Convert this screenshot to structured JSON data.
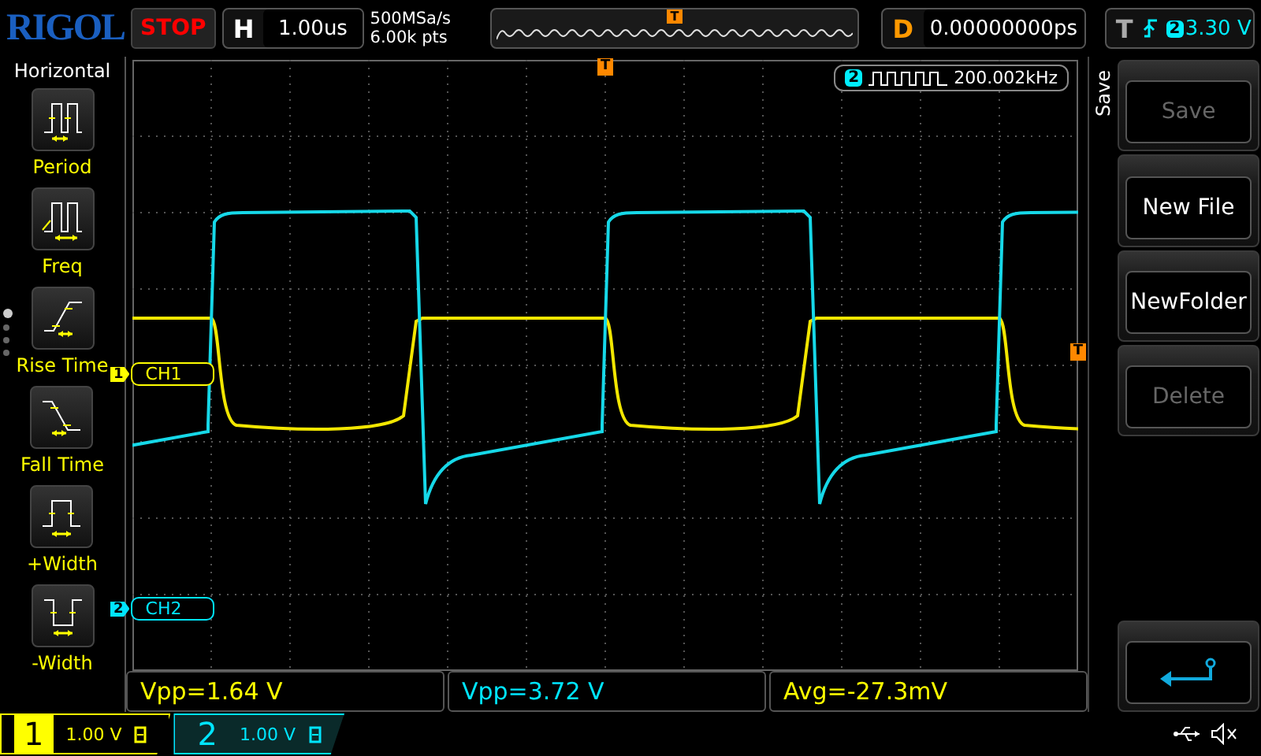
{
  "header": {
    "brand": "RIGOL",
    "run_state": "STOP",
    "timebase": {
      "label": "H",
      "value": "1.00us"
    },
    "sample_rate": "500MSa/s",
    "memory_depth": "6.00k pts",
    "overview_marker": "T",
    "delay": {
      "label": "D",
      "value": "0.00000000ps"
    },
    "trigger": {
      "label": "T",
      "source": "2",
      "level": "3.30 V"
    }
  },
  "left_menu": {
    "title": "Horizontal",
    "items": [
      {
        "label": "Period",
        "kind": "period"
      },
      {
        "label": "Freq",
        "kind": "freq"
      },
      {
        "label": "Rise Time",
        "kind": "rise"
      },
      {
        "label": "Fall Time",
        "kind": "fall"
      },
      {
        "label": "+Width",
        "kind": "pwidth"
      },
      {
        "label": "-Width",
        "kind": "nwidth"
      }
    ],
    "pages": [
      {
        "selected": true
      },
      {
        "selected": false
      },
      {
        "selected": false
      },
      {
        "selected": false
      }
    ]
  },
  "display": {
    "top_trigger_marker": "T",
    "side_trigger_marker": "T",
    "frequency_counter": {
      "channel": "2",
      "value": "200.002kHz"
    },
    "channel_markers": [
      {
        "number": "1",
        "label": "CH1",
        "color": "#ffff00"
      },
      {
        "number": "2",
        "label": "CH2",
        "color": "#00e5ff"
      }
    ]
  },
  "measurements": [
    {
      "text": "Vpp=1.64 V",
      "color": "#ffff00"
    },
    {
      "text": "Vpp=3.72 V",
      "color": "#00e5ff"
    },
    {
      "text": "Avg=-27.3mV",
      "color": "#ffff00"
    }
  ],
  "right_menu": {
    "title": "Save",
    "buttons": [
      {
        "kind": "text",
        "label": "Save",
        "disabled": true
      },
      {
        "kind": "text",
        "label": "New File",
        "disabled": false
      },
      {
        "kind": "text",
        "label": "NewFolder",
        "disabled": false
      },
      {
        "kind": "text",
        "label": "Delete",
        "disabled": true
      },
      {
        "kind": "spacer"
      },
      {
        "kind": "back"
      }
    ]
  },
  "channels": [
    {
      "number": "1",
      "scale": "1.00 V",
      "active": true,
      "color": "#ffff00"
    },
    {
      "number": "2",
      "scale": "1.00 V",
      "active": false,
      "color": "#00e5ff"
    }
  ]
}
